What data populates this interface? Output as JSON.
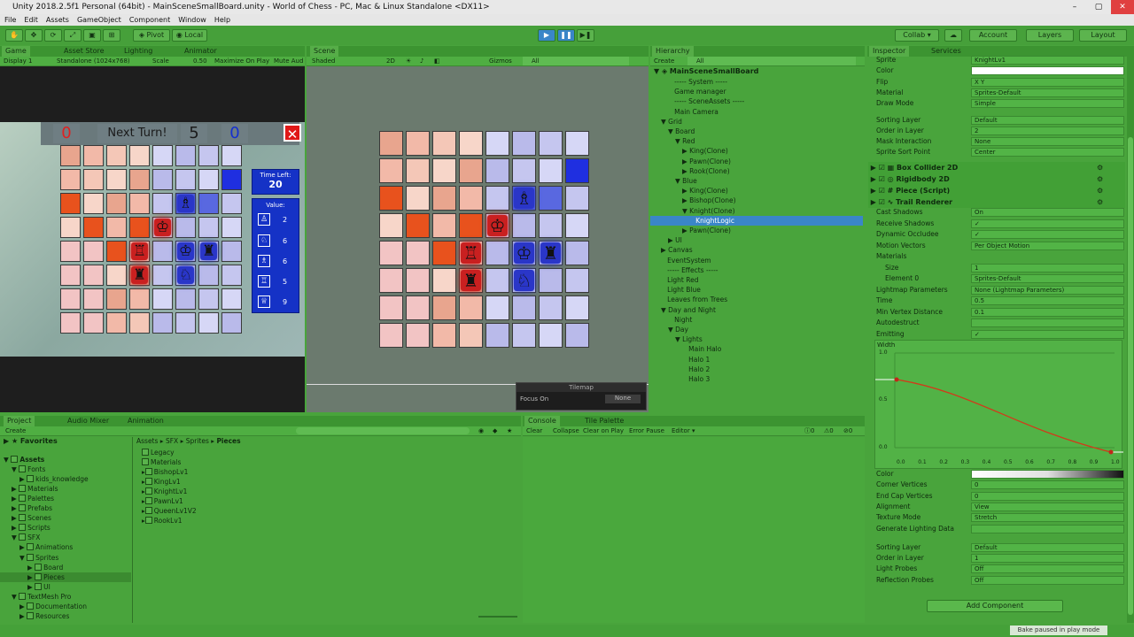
{
  "window": {
    "title": "Unity 2018.2.5f1 Personal (64bit) - MainSceneSmallBoard.unity - World of Chess - PC, Mac & Linux Standalone <DX11>"
  },
  "menu": [
    "File",
    "Edit",
    "Assets",
    "GameObject",
    "Component",
    "Window",
    "Help"
  ],
  "toolbar": {
    "pivot": "Pivot",
    "local": "Local",
    "collab": "Collab ▾",
    "account": "Account",
    "layers": "Layers",
    "layout": "Layout"
  },
  "game_panel": {
    "tabs": [
      "Game",
      "Asset Store",
      "Lighting",
      "Animator"
    ],
    "display": "Display 1",
    "resolution": "Standalone (1024x768)",
    "scale_label": "Scale",
    "scale_value": "0.50",
    "maximize": "Maximize On Play",
    "mute": "Mute Aud"
  },
  "game_hud": {
    "red_score": "0",
    "turn_label": "Next Turn!",
    "turn_count": "5",
    "blue_score": "0",
    "time_left_label": "Time Left:",
    "time_left": "20",
    "value_label": "Value:",
    "values": [
      "2",
      "6",
      "6",
      "5",
      "9"
    ]
  },
  "scene_panel": {
    "tab": "Scene",
    "shading": "Shaded",
    "mode_2d": "2D",
    "gizmos": "Gizmos",
    "search": "All",
    "tilemap_title": "Tilemap",
    "focus_label": "Focus On",
    "focus_value": "None"
  },
  "hierarchy": {
    "tab": "Hierarchy",
    "create": "Create",
    "search": "All",
    "root": "MainSceneSmallBoard",
    "items": [
      "----- System -----",
      "Game manager",
      "----- SceneAssets -----",
      "Main Camera",
      "Grid",
      "Board",
      "Red",
      "King(Clone)",
      "Pawn(Clone)",
      "Rook(Clone)",
      "Blue",
      "King(Clone)",
      "Bishop(Clone)",
      "Knight(Clone)",
      "KnightLogic",
      "Pawn(Clone)",
      "UI",
      "Canvas",
      "EventSystem",
      "----- Effects -----",
      "Light Red",
      "Light Blue",
      "Leaves from Trees",
      "Day and Night",
      "Night",
      "Day",
      "Lights",
      "Main Halo",
      "Halo 1",
      "Halo 2",
      "Halo 3"
    ]
  },
  "inspector": {
    "tabs": [
      "Inspector",
      "Services"
    ],
    "sprite_rows": [
      {
        "label": "Sprite",
        "value": "KnightLv1"
      },
      {
        "label": "Color",
        "value": ""
      },
      {
        "label": "Flip",
        "value": "X  Y"
      },
      {
        "label": "Material",
        "value": "Sprites-Default"
      },
      {
        "label": "Draw Mode",
        "value": "Simple"
      },
      {
        "label": "Sorting Layer",
        "value": "Default"
      },
      {
        "label": "Order in Layer",
        "value": "2"
      },
      {
        "label": "Mask Interaction",
        "value": "None"
      },
      {
        "label": "Sprite Sort Point",
        "value": "Center"
      }
    ],
    "components": [
      "Box Collider 2D",
      "Rigidbody 2D",
      "Piece (Script)",
      "Trail Renderer"
    ],
    "trail_rows": [
      {
        "label": "Cast Shadows",
        "value": "On"
      },
      {
        "label": "Receive Shadows",
        "value": "✓"
      },
      {
        "label": "Dynamic Occludee",
        "value": "✓"
      },
      {
        "label": "Motion Vectors",
        "value": "Per Object Motion"
      },
      {
        "label": "Materials",
        "value": ""
      },
      {
        "label": "Size",
        "value": "1"
      },
      {
        "label": "Element 0",
        "value": "Sprites-Default"
      },
      {
        "label": "Lightmap Parameters",
        "value": "None (Lightmap Parameters)"
      },
      {
        "label": "Time",
        "value": "0.5"
      },
      {
        "label": "Min Vertex Distance",
        "value": "0.1"
      },
      {
        "label": "Autodestruct",
        "value": ""
      },
      {
        "label": "Emitting",
        "value": "✓"
      }
    ],
    "width_label": "Width",
    "curve_y": [
      "1.0",
      "0.5",
      "0.0"
    ],
    "curve_x": [
      "0.0",
      "0.1",
      "0.2",
      "0.3",
      "0.4",
      "0.5",
      "0.6",
      "0.7",
      "0.8",
      "0.9",
      "1.0"
    ],
    "bottom_rows": [
      {
        "label": "Color",
        "value": ""
      },
      {
        "label": "Corner Vertices",
        "value": "0"
      },
      {
        "label": "End Cap Vertices",
        "value": "0"
      },
      {
        "label": "Alignment",
        "value": "View"
      },
      {
        "label": "Texture Mode",
        "value": "Stretch"
      },
      {
        "label": "Generate Lighting Data",
        "value": ""
      },
      {
        "label": "Sorting Layer",
        "value": "Default"
      },
      {
        "label": "Order in Layer",
        "value": "1"
      },
      {
        "label": "Light Probes",
        "value": "Off"
      },
      {
        "label": "Reflection Probes",
        "value": "Off"
      }
    ],
    "add_component": "Add Component"
  },
  "project": {
    "tabs": [
      "Project",
      "Audio Mixer",
      "Animation"
    ],
    "create": "Create",
    "favorites": "Favorites",
    "tree": [
      "Assets",
      "Fonts",
      "kids_knowledge",
      "Materials",
      "Palettes",
      "Prefabs",
      "Scenes",
      "Scripts",
      "SFX",
      "Animations",
      "Sprites",
      "Board",
      "Pieces",
      "UI",
      "TextMesh Pro",
      "Documentation",
      "Resources"
    ],
    "breadcrumb": [
      "Assets",
      "SFX",
      "Sprites",
      "Pieces"
    ],
    "files": [
      "Legacy",
      "Materials",
      "BishopLv1",
      "KingLv1",
      "KnightLv1",
      "PawnLv1",
      "QueenLv1V2",
      "RookLv1"
    ]
  },
  "console": {
    "tabs": [
      "Console",
      "Tile Palette"
    ],
    "buttons": [
      "Clear",
      "Collapse",
      "Clear on Play",
      "Error Pause",
      "Editor ▾"
    ],
    "counts": [
      "0",
      "0",
      "0"
    ]
  },
  "status": "Bake paused in play mode"
}
